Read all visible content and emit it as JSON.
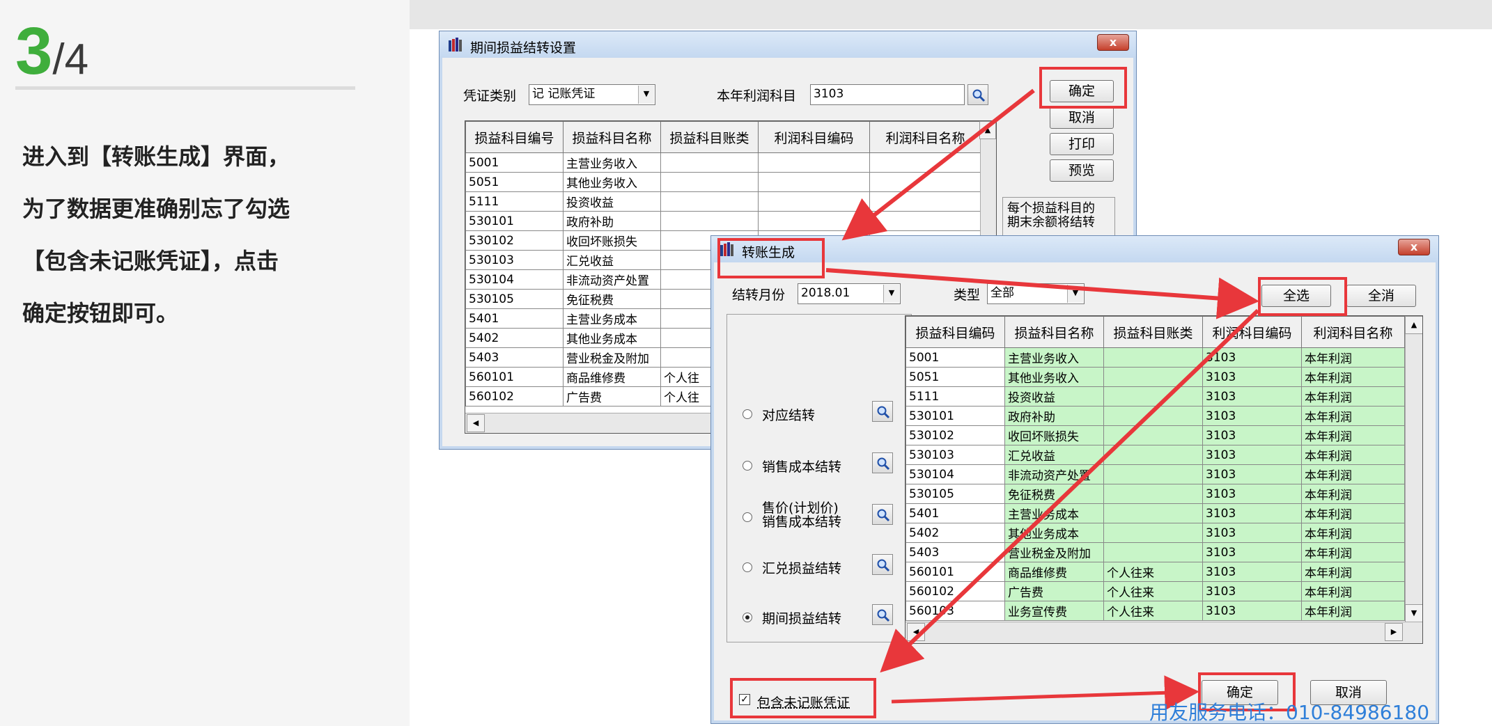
{
  "step": {
    "current": "3",
    "total": "/4"
  },
  "instructions": [
    "进入到【转账生成】界面，",
    "为了数据更准确别忘了勾选",
    "【包含未记账凭证】，点击",
    "确定按钮即可。"
  ],
  "back_window": {
    "title": "期间损益结转设置",
    "close": "x",
    "voucher_type_label": "凭证类别",
    "voucher_type_value": "记   记账凭证",
    "profit_account_label": "本年利润科目",
    "profit_account_value": "3103",
    "buttons": {
      "ok": "确定",
      "cancel": "取消",
      "print": "打印",
      "preview": "预览"
    },
    "note": "每个损益科目的\n期末余额将结转",
    "columns": [
      "损益科目编号",
      "损益科目名称",
      "损益科目账类",
      "利润科目编码",
      "利润科目名称"
    ],
    "rows": [
      [
        "5001",
        "主营业务收入",
        "",
        "",
        ""
      ],
      [
        "5051",
        "其他业务收入",
        "",
        "",
        ""
      ],
      [
        "5111",
        "投资收益",
        "",
        "",
        ""
      ],
      [
        "530101",
        "政府补助",
        "",
        "",
        ""
      ],
      [
        "530102",
        "收回坏账损失",
        "",
        "",
        ""
      ],
      [
        "530103",
        "汇兑收益",
        "",
        "",
        ""
      ],
      [
        "530104",
        "非流动资产处置",
        "",
        "",
        ""
      ],
      [
        "530105",
        "免征税费",
        "",
        "",
        ""
      ],
      [
        "5401",
        "主营业务成本",
        "",
        "",
        ""
      ],
      [
        "5402",
        "其他业务成本",
        "",
        "",
        ""
      ],
      [
        "5403",
        "营业税金及附加",
        "",
        "",
        ""
      ],
      [
        "560101",
        "商品维修费",
        "个人往",
        "",
        ""
      ],
      [
        "560102",
        "广告费",
        "个人往",
        "",
        ""
      ]
    ]
  },
  "front_window": {
    "title": "转账生成",
    "close": "x",
    "month_label": "结转月份",
    "month_value": "2018.01",
    "type_label": "类型",
    "type_value": "全部",
    "select_all": "全选",
    "deselect_all": "全消",
    "options": [
      "对应结转",
      "销售成本结转",
      "售价(计划价)\n销售成本结转",
      "汇兑损益结转",
      "期间损益结转"
    ],
    "include_unposted_label": "包含未记账凭证",
    "ok": "确定",
    "cancel": "取消",
    "columns": [
      "损益科目编码",
      "损益科目名称",
      "损益科目账类",
      "利润科目编码",
      "利润科目名称"
    ],
    "rows": [
      [
        "5001",
        "主营业务收入",
        "",
        "3103",
        "本年利润"
      ],
      [
        "5051",
        "其他业务收入",
        "",
        "3103",
        "本年利润"
      ],
      [
        "5111",
        "投资收益",
        "",
        "3103",
        "本年利润"
      ],
      [
        "530101",
        "政府补助",
        "",
        "3103",
        "本年利润"
      ],
      [
        "530102",
        "收回坏账损失",
        "",
        "3103",
        "本年利润"
      ],
      [
        "530103",
        "汇兑收益",
        "",
        "3103",
        "本年利润"
      ],
      [
        "530104",
        "非流动资产处置",
        "",
        "3103",
        "本年利润"
      ],
      [
        "530105",
        "免征税费",
        "",
        "3103",
        "本年利润"
      ],
      [
        "5401",
        "主营业务成本",
        "",
        "3103",
        "本年利润"
      ],
      [
        "5402",
        "其他业务成本",
        "",
        "3103",
        "本年利润"
      ],
      [
        "5403",
        "营业税金及附加",
        "",
        "3103",
        "本年利润"
      ],
      [
        "560101",
        "商品维修费",
        "个人往来",
        "3103",
        "本年利润"
      ],
      [
        "560102",
        "广告费",
        "个人往来",
        "3103",
        "本年利润"
      ],
      [
        "560103",
        "业务宣传费",
        "个人往来",
        "3103",
        "本年利润"
      ]
    ]
  },
  "phone_text": "用友服务电话：010-84986180",
  "colors": {
    "green_step": "#3fae3c",
    "highlight_red": "#e8373b",
    "grid_green": "#c8f5c8",
    "phone_blue": "#2f7fd9"
  }
}
